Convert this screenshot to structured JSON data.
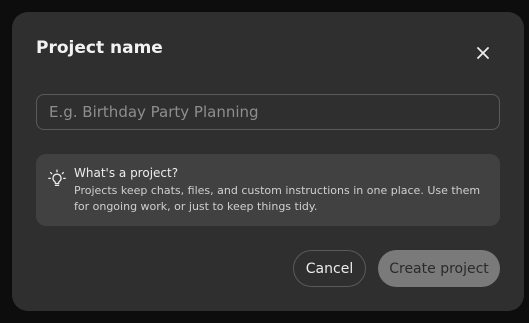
{
  "dialog": {
    "title": "Project name",
    "close_icon": "close-icon",
    "input": {
      "value": "",
      "placeholder": "E.g. Birthday Party Planning"
    },
    "info": {
      "icon": "lightbulb-icon",
      "heading": "What's a project?",
      "body": "Projects keep chats, files, and custom instructions in one place. Use them for ongoing work, or just to keep things tidy."
    },
    "buttons": {
      "cancel_label": "Cancel",
      "create_label": "Create project"
    }
  },
  "colors": {
    "backdrop": "#0d0d0d",
    "dialog_bg": "#2f2f2f",
    "info_bg": "#414141",
    "primary_disabled": "#7a7a7a"
  }
}
